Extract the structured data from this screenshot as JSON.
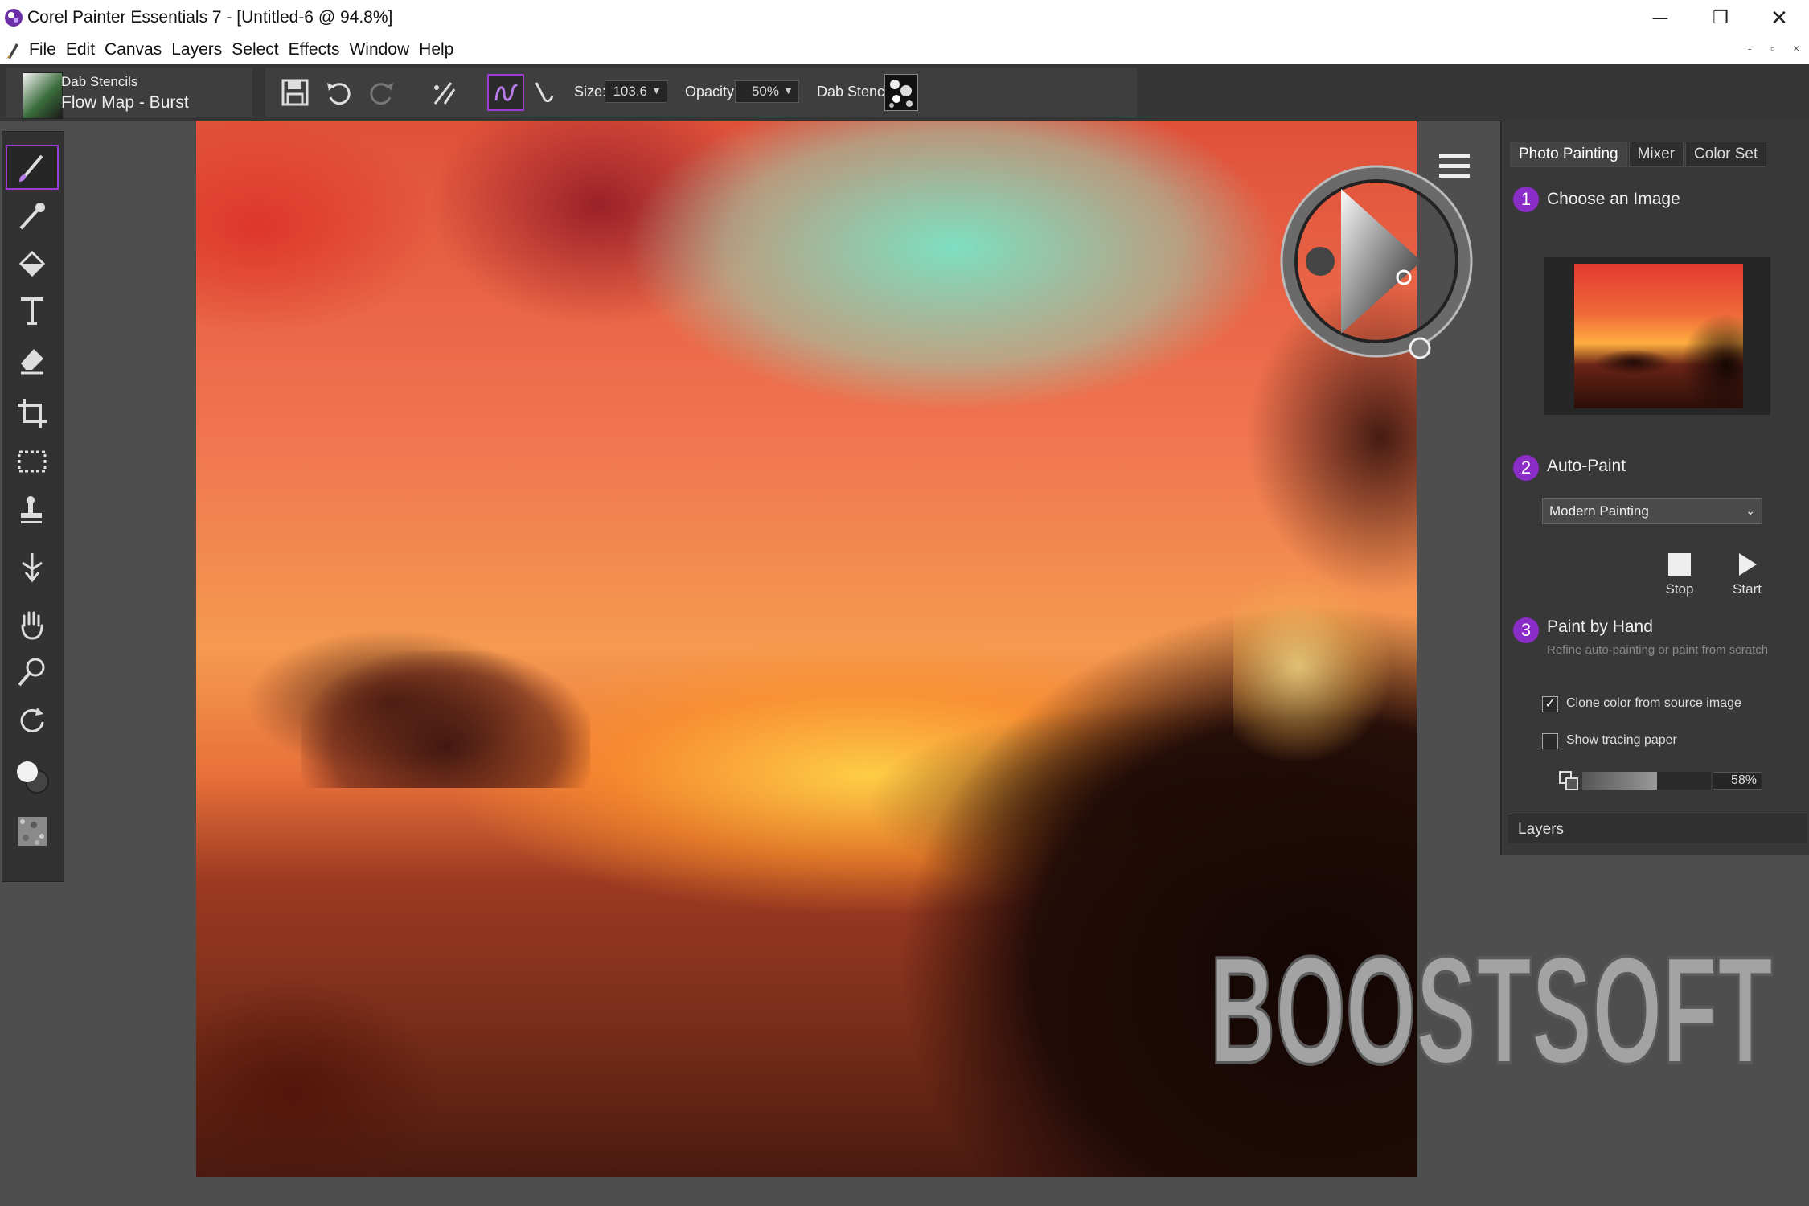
{
  "window": {
    "title": "Corel Painter Essentials 7 - [Untitled-6 @ 94.8%]",
    "controls": {
      "minimize": "─",
      "restore": "❐",
      "close": "✕"
    },
    "mdi_controls": {
      "minimize": "-",
      "restore": "▫",
      "close": "×"
    }
  },
  "menu": [
    "File",
    "Edit",
    "Canvas",
    "Layers",
    "Select",
    "Effects",
    "Window",
    "Help"
  ],
  "propbar": {
    "brush_category": "Dab Stencils",
    "brush_variant": "Flow Map - Burst",
    "size_label": "Size:",
    "size_value": "103.6",
    "opacity_label": "Opacity:",
    "opacity_value": "50%",
    "dab_stencil_label": "Dab Stencil:"
  },
  "tools": [
    "brush-tool",
    "dropper-tool",
    "paint-bucket-tool",
    "text-tool",
    "eraser-tool",
    "crop-tool",
    "rectangular-selection-tool",
    "clone-stamp-tool",
    "transform-tool",
    "grabber-tool",
    "magnifier-tool",
    "rotate-page-tool",
    "color-swatches",
    "paper-texture"
  ],
  "panel": {
    "tabs": [
      "Photo Painting",
      "Mixer",
      "Color Set"
    ],
    "active_tab": "Photo Painting",
    "step1": {
      "num": "1",
      "label": "Choose an Image"
    },
    "step2": {
      "num": "2",
      "label": "Auto-Paint"
    },
    "style": "Modern Painting",
    "stop_label": "Stop",
    "start_label": "Start",
    "step3": {
      "num": "3",
      "label": "Paint by Hand",
      "hint": "Refine auto-painting or paint from scratch"
    },
    "clone_color": {
      "label": "Clone color from source image",
      "checked": true
    },
    "tracing_paper": {
      "label": "Show tracing paper",
      "checked": false
    },
    "tracing_opacity": 58,
    "tracing_opacity_text": "58%",
    "layers_label": "Layers"
  },
  "watermark": "BOOSTSOFT",
  "colors": {
    "accent": "#8a2cc6",
    "panel": "#383838",
    "toolbar": "#353535"
  }
}
